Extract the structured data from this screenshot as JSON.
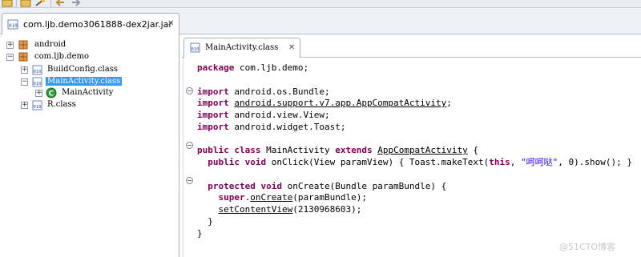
{
  "app": {
    "file_tab": "com.ljb.demo3061888-dex2jar.jar",
    "editor_tab": "MainActivity.class"
  },
  "tree": {
    "items": [
      {
        "label": "android",
        "type": "package"
      },
      {
        "label": "com.ljb.demo",
        "type": "package"
      },
      {
        "label": "BuildConfig.class",
        "type": "class-file"
      },
      {
        "label": "MainActivity.class",
        "type": "class-file",
        "selected": true
      },
      {
        "label": "MainActivity",
        "type": "class"
      },
      {
        "label": "R.class",
        "type": "class-file"
      }
    ]
  },
  "code": {
    "package_kw": "package",
    "package_name": " com.ljb.demo;",
    "imports": [
      {
        "kw": "import",
        "name": "android.os.Bundle",
        "underline": false
      },
      {
        "kw": "import",
        "name": "android.support.v7.app.AppCompatActivity",
        "underline": true
      },
      {
        "kw": "import",
        "name": "android.view.View",
        "underline": false
      },
      {
        "kw": "import",
        "name": "android.widget.Toast",
        "underline": false
      }
    ],
    "class_kw1": "public",
    "class_kw2": "class",
    "class_name": " MainActivity ",
    "extends_kw": "extends",
    "super_class": "AppCompatActivity",
    "class_open": " {",
    "onclick_kw1": "public",
    "onclick_kw2": "void",
    "onclick_body1": " onClick(View paramView) { Toast.makeText(",
    "onclick_this": "this",
    "onclick_comma": ", ",
    "onclick_str": "\"呵呵哒\"",
    "onclick_body2": ", 0).show(); }",
    "oncreate_kw1": "protected",
    "oncreate_kw2": "void",
    "oncreate_sig": " onCreate(Bundle paramBundle) {",
    "super_kw": "super",
    "super_dot": ".",
    "super_call": "onCreate",
    "super_args": "(paramBundle);",
    "set_content": "setContentView",
    "set_args": "(2130968603);",
    "close_inner": "}",
    "close_outer": "}"
  },
  "watermark": "@51CTO博客",
  "colors": {
    "keyword": "#7f0055",
    "string": "#2a00ff",
    "selection": "#3399ff"
  }
}
